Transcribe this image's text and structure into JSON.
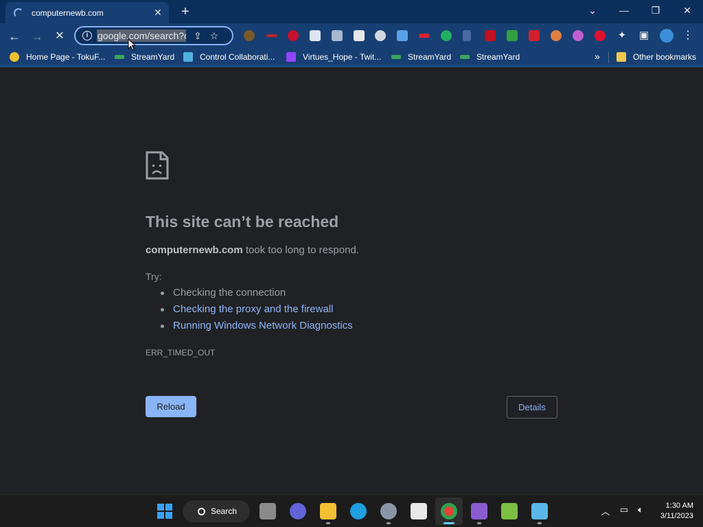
{
  "browser": {
    "tab_title": "computernewb.com",
    "url": "google.com/search?c",
    "colors": {
      "titlebar": "#0b2f5c",
      "toolbar": "#173f73",
      "accent": "#8ab4f8"
    }
  },
  "bookmarks": [
    {
      "label": "Home Page - TokuF...",
      "icon": "tokufoods-icon",
      "color": "#f2c230"
    },
    {
      "label": "StreamYard",
      "icon": "streamyard-icon",
      "color": "#3aa55c"
    },
    {
      "label": "Control Collaborati...",
      "icon": "monitor-icon",
      "color": "#4fb0e0"
    },
    {
      "label": "Virtues_Hope - Twit...",
      "icon": "twitch-icon",
      "color": "#9146ff"
    },
    {
      "label": "StreamYard",
      "icon": "streamyard-icon",
      "color": "#3aa55c"
    },
    {
      "label": "StreamYard",
      "icon": "streamyard-icon",
      "color": "#3aa55c"
    }
  ],
  "other_bookmarks": "Other bookmarks",
  "overflow_label": "»",
  "error_page": {
    "headline": "This site can’t be reached",
    "host": "computernewb.com",
    "message": " took too long to respond.",
    "try_label": "Try:",
    "suggestions": [
      {
        "text": "Checking the connection",
        "link": false
      },
      {
        "text": "Checking the proxy and the firewall",
        "link": true
      },
      {
        "text": "Running Windows Network Diagnostics",
        "link": true
      }
    ],
    "error_code": "ERR_TIMED_OUT",
    "reload_label": "Reload",
    "details_label": "Details"
  },
  "taskbar": {
    "search_label": "Search",
    "time": "1:30 AM",
    "date": "3/11/2023"
  }
}
